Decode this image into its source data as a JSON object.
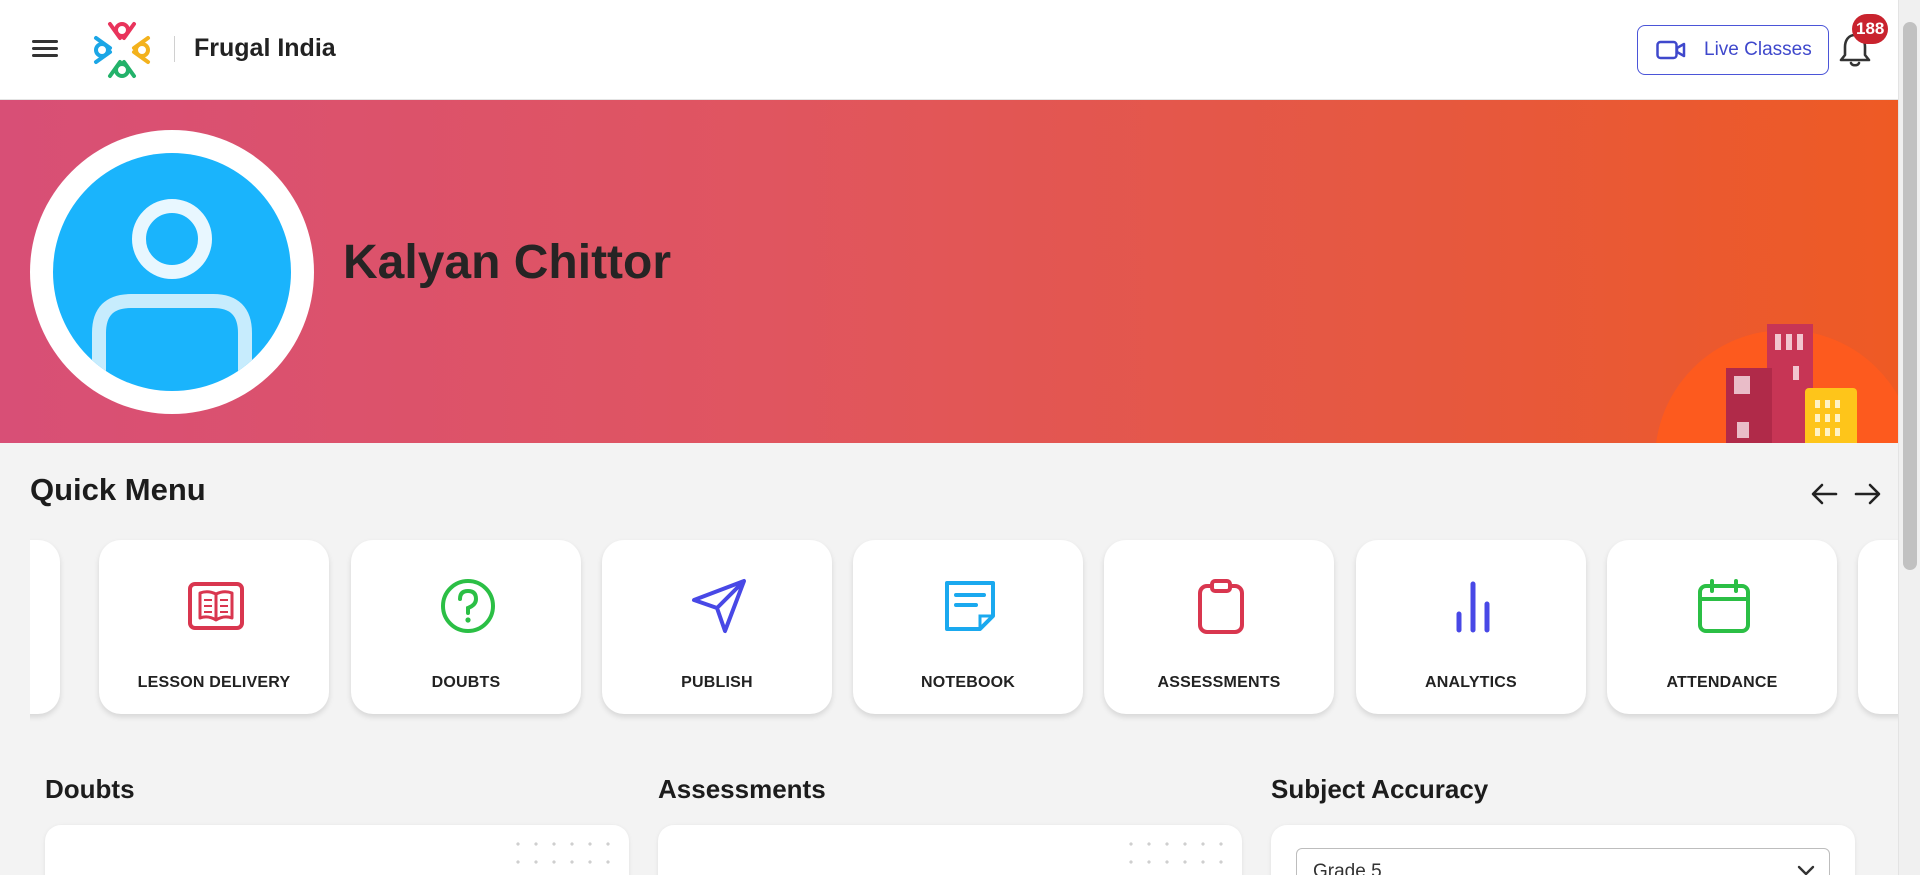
{
  "header": {
    "brand": "Frugal India",
    "live_classes_label": "Live Classes",
    "notification_count": "188"
  },
  "profile": {
    "name": "Kalyan Chittor"
  },
  "quick_menu": {
    "title": "Quick Menu",
    "items": [
      {
        "label": "",
        "icon": "partial-card"
      },
      {
        "label": "LESSON DELIVERY",
        "icon": "open-book-icon",
        "color": "#d9364f"
      },
      {
        "label": "DOUBTS",
        "icon": "question-circle-icon",
        "color": "#2bbf45"
      },
      {
        "label": "PUBLISH",
        "icon": "paper-plane-icon",
        "color": "#4848e6"
      },
      {
        "label": "NOTEBOOK",
        "icon": "notebook-icon",
        "color": "#1aa9ef"
      },
      {
        "label": "ASSESSMENTS",
        "icon": "clipboard-icon",
        "color": "#d9364f"
      },
      {
        "label": "ANALYTICS",
        "icon": "bar-chart-icon",
        "color": "#4848e6"
      },
      {
        "label": "ATTENDANCE",
        "icon": "calendar-icon",
        "color": "#2bbf45"
      }
    ]
  },
  "sections": {
    "doubts_title": "Doubts",
    "assessments_title": "Assessments",
    "subject_accuracy_title": "Subject Accuracy",
    "grade_select_value": "Grade 5"
  },
  "colors": {
    "accent": "#3f48cc",
    "badge": "#c9232e",
    "avatar_bg": "#1ab4fc",
    "banner_start": "#d84f76",
    "banner_end": "#ee5a24"
  }
}
